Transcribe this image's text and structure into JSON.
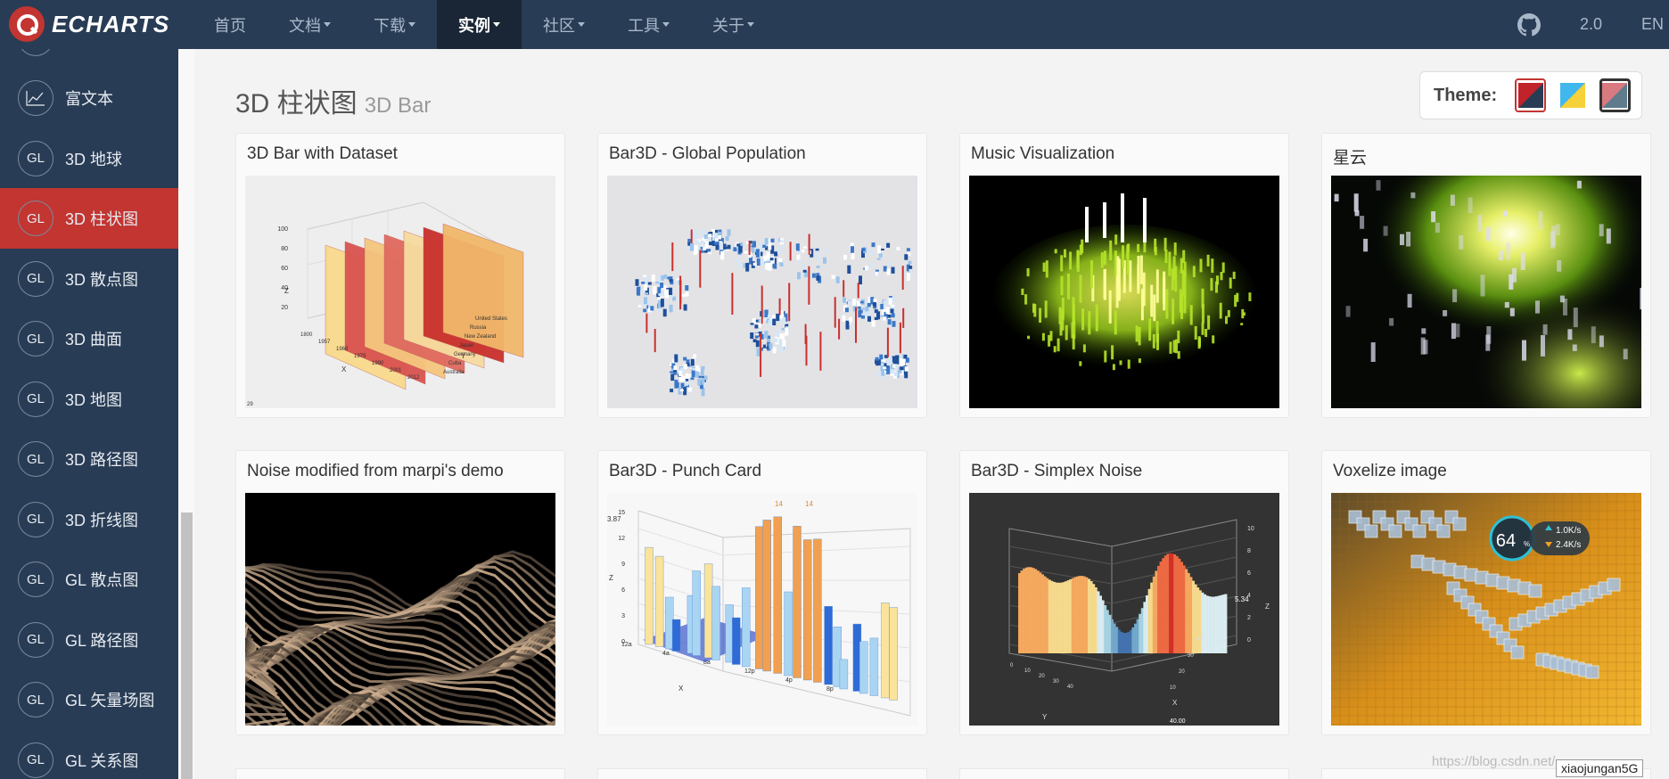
{
  "navbar": {
    "logo": "ECHARTS",
    "items": [
      {
        "label": "首页",
        "dropdown": false,
        "active": false
      },
      {
        "label": "文档",
        "dropdown": true,
        "active": false
      },
      {
        "label": "下载",
        "dropdown": true,
        "active": false
      },
      {
        "label": "实例",
        "dropdown": true,
        "active": true
      },
      {
        "label": "社区",
        "dropdown": true,
        "active": false
      },
      {
        "label": "工具",
        "dropdown": true,
        "active": false
      },
      {
        "label": "关于",
        "dropdown": true,
        "active": false
      }
    ],
    "version": "2.0",
    "language": "EN",
    "github_icon": "github-icon"
  },
  "sidebar": {
    "items": [
      {
        "icon": "line-chart-icon",
        "icon_text": "",
        "label": "富文本",
        "active": false
      },
      {
        "icon": "gl-icon",
        "icon_text": "GL",
        "label": "3D 地球",
        "active": false
      },
      {
        "icon": "gl-icon",
        "icon_text": "GL",
        "label": "3D 柱状图",
        "active": true
      },
      {
        "icon": "gl-icon",
        "icon_text": "GL",
        "label": "3D 散点图",
        "active": false
      },
      {
        "icon": "gl-icon",
        "icon_text": "GL",
        "label": "3D 曲面",
        "active": false
      },
      {
        "icon": "gl-icon",
        "icon_text": "GL",
        "label": "3D 地图",
        "active": false
      },
      {
        "icon": "gl-icon",
        "icon_text": "GL",
        "label": "3D 路径图",
        "active": false
      },
      {
        "icon": "gl-icon",
        "icon_text": "GL",
        "label": "3D 折线图",
        "active": false
      },
      {
        "icon": "gl-icon",
        "icon_text": "GL",
        "label": "GL 散点图",
        "active": false
      },
      {
        "icon": "gl-icon",
        "icon_text": "GL",
        "label": "GL 路径图",
        "active": false
      },
      {
        "icon": "gl-icon",
        "icon_text": "GL",
        "label": "GL 矢量场图",
        "active": false
      },
      {
        "icon": "gl-icon",
        "icon_text": "GL",
        "label": "GL 关系图",
        "active": false
      }
    ],
    "active_color": "#c23531"
  },
  "main": {
    "title": "3D 柱状图",
    "subtitle": "3D Bar",
    "theme": {
      "label": "Theme:",
      "swatches": [
        "theme-default",
        "theme-light",
        "theme-dark"
      ]
    },
    "cards": [
      {
        "title": "3D Bar with Dataset",
        "thumb": "bar-dataset"
      },
      {
        "title": "Bar3D - Global Population",
        "thumb": "population"
      },
      {
        "title": "Music Visualization",
        "thumb": "music"
      },
      {
        "title": "星云",
        "thumb": "nebula"
      },
      {
        "title": "Noise modified from marpi's demo",
        "thumb": "noise"
      },
      {
        "title": "Bar3D - Punch Card",
        "thumb": "punch"
      },
      {
        "title": "Bar3D - Simplex Noise",
        "thumb": "simplex"
      },
      {
        "title": "Voxelize image",
        "thumb": "voxel"
      }
    ]
  },
  "thumb_text": {
    "dataset_z": "Z",
    "dataset_x": "X",
    "dataset_y": "Y",
    "dataset_zticks": [
      "100",
      "80",
      "60",
      "40",
      "20"
    ],
    "dataset_xticks": [
      "1800",
      "1957",
      "1968",
      "1979",
      "1990",
      "2001",
      "2012"
    ],
    "dataset_countries": [
      "United States",
      "Russia",
      "New Zealand",
      "Japan",
      "Germany",
      "Cuba",
      "Australia"
    ],
    "dataset_corner": "29",
    "punch_value": "3.87",
    "punch_yticks": [
      "15",
      "12",
      "9",
      "6",
      "3",
      "0"
    ],
    "punch_xlabel": "X",
    "punch_zlabel": "Z",
    "punch_xticks": [
      "12a",
      "4a",
      "8a",
      "12p",
      "4p",
      "8p"
    ],
    "punch_peak_labels": [
      "14",
      "14"
    ],
    "simplex_value": "5.34",
    "simplex_zticks": [
      "10",
      "8",
      "6",
      "4",
      "2",
      "0"
    ],
    "simplex_zlabel": "Z",
    "simplex_xlabel": "X",
    "simplex_ylabel": "Y",
    "simplex_xticks": [
      "0",
      "10",
      "20",
      "30",
      "40"
    ],
    "simplex_yticks": [
      "10",
      "20",
      "30",
      "40"
    ],
    "simplex_corner": "40.00",
    "voxel_percent": "64",
    "voxel_unit": "%",
    "voxel_up": "1.0K/s",
    "voxel_down": "2.4K/s"
  },
  "watermark": "https://blog.csdn.net/...",
  "badge": "xiaojungan5G"
}
